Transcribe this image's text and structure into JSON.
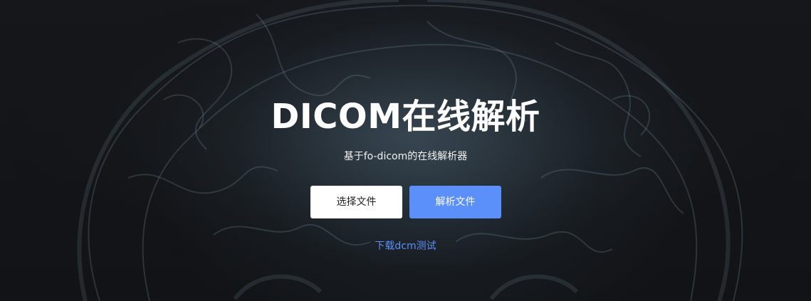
{
  "hero": {
    "title": "DICOM在线解析",
    "subtitle": "基于fo-dicom的在线解析器",
    "choose_file_label": "选择文件",
    "parse_file_label": "解析文件",
    "download_test_label": "下载dcm测试",
    "background_image": "brain-scan-background"
  },
  "colors": {
    "background": "#121418",
    "title": "#ffffff",
    "primary_button": "#5b8ff9",
    "secondary_button": "#ffffff",
    "link": "#5b8ff9"
  }
}
